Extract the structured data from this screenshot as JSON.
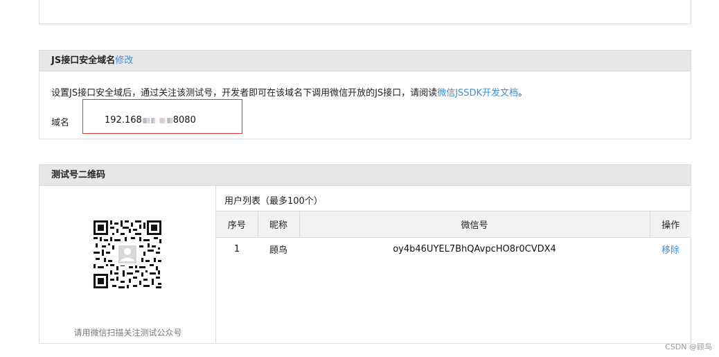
{
  "js_section": {
    "title": "JS接口安全域名",
    "edit_label": "修改",
    "desc_prefix": "设置JS接口安全域后，通过关注该测试号，开发者即可在该域名下调用微信开放的JS接口，请阅读",
    "doc_link": "微信JSSDK开发文档",
    "desc_suffix": "。",
    "domain_label": "域名",
    "domain_start": "192.168",
    "domain_end": "8080"
  },
  "qr_section": {
    "title": "测试号二维码",
    "caption": "请用微信扫描关注测试公众号",
    "list_title": "用户列表（最多100个）",
    "columns": [
      "序号",
      "昵称",
      "微信号",
      "操作"
    ],
    "rows": [
      {
        "index": "1",
        "nickname": "顾鸟",
        "wechat_id": "oy4b46UYEL7BhQAvpcHO8r0CVDX4",
        "action": "移除"
      }
    ]
  },
  "watermark": "CSDN @顾鸟",
  "colors": {
    "link": "#3c8fd6",
    "highlight_box": "#e0323c",
    "header_bg": "#e7e7e7"
  }
}
